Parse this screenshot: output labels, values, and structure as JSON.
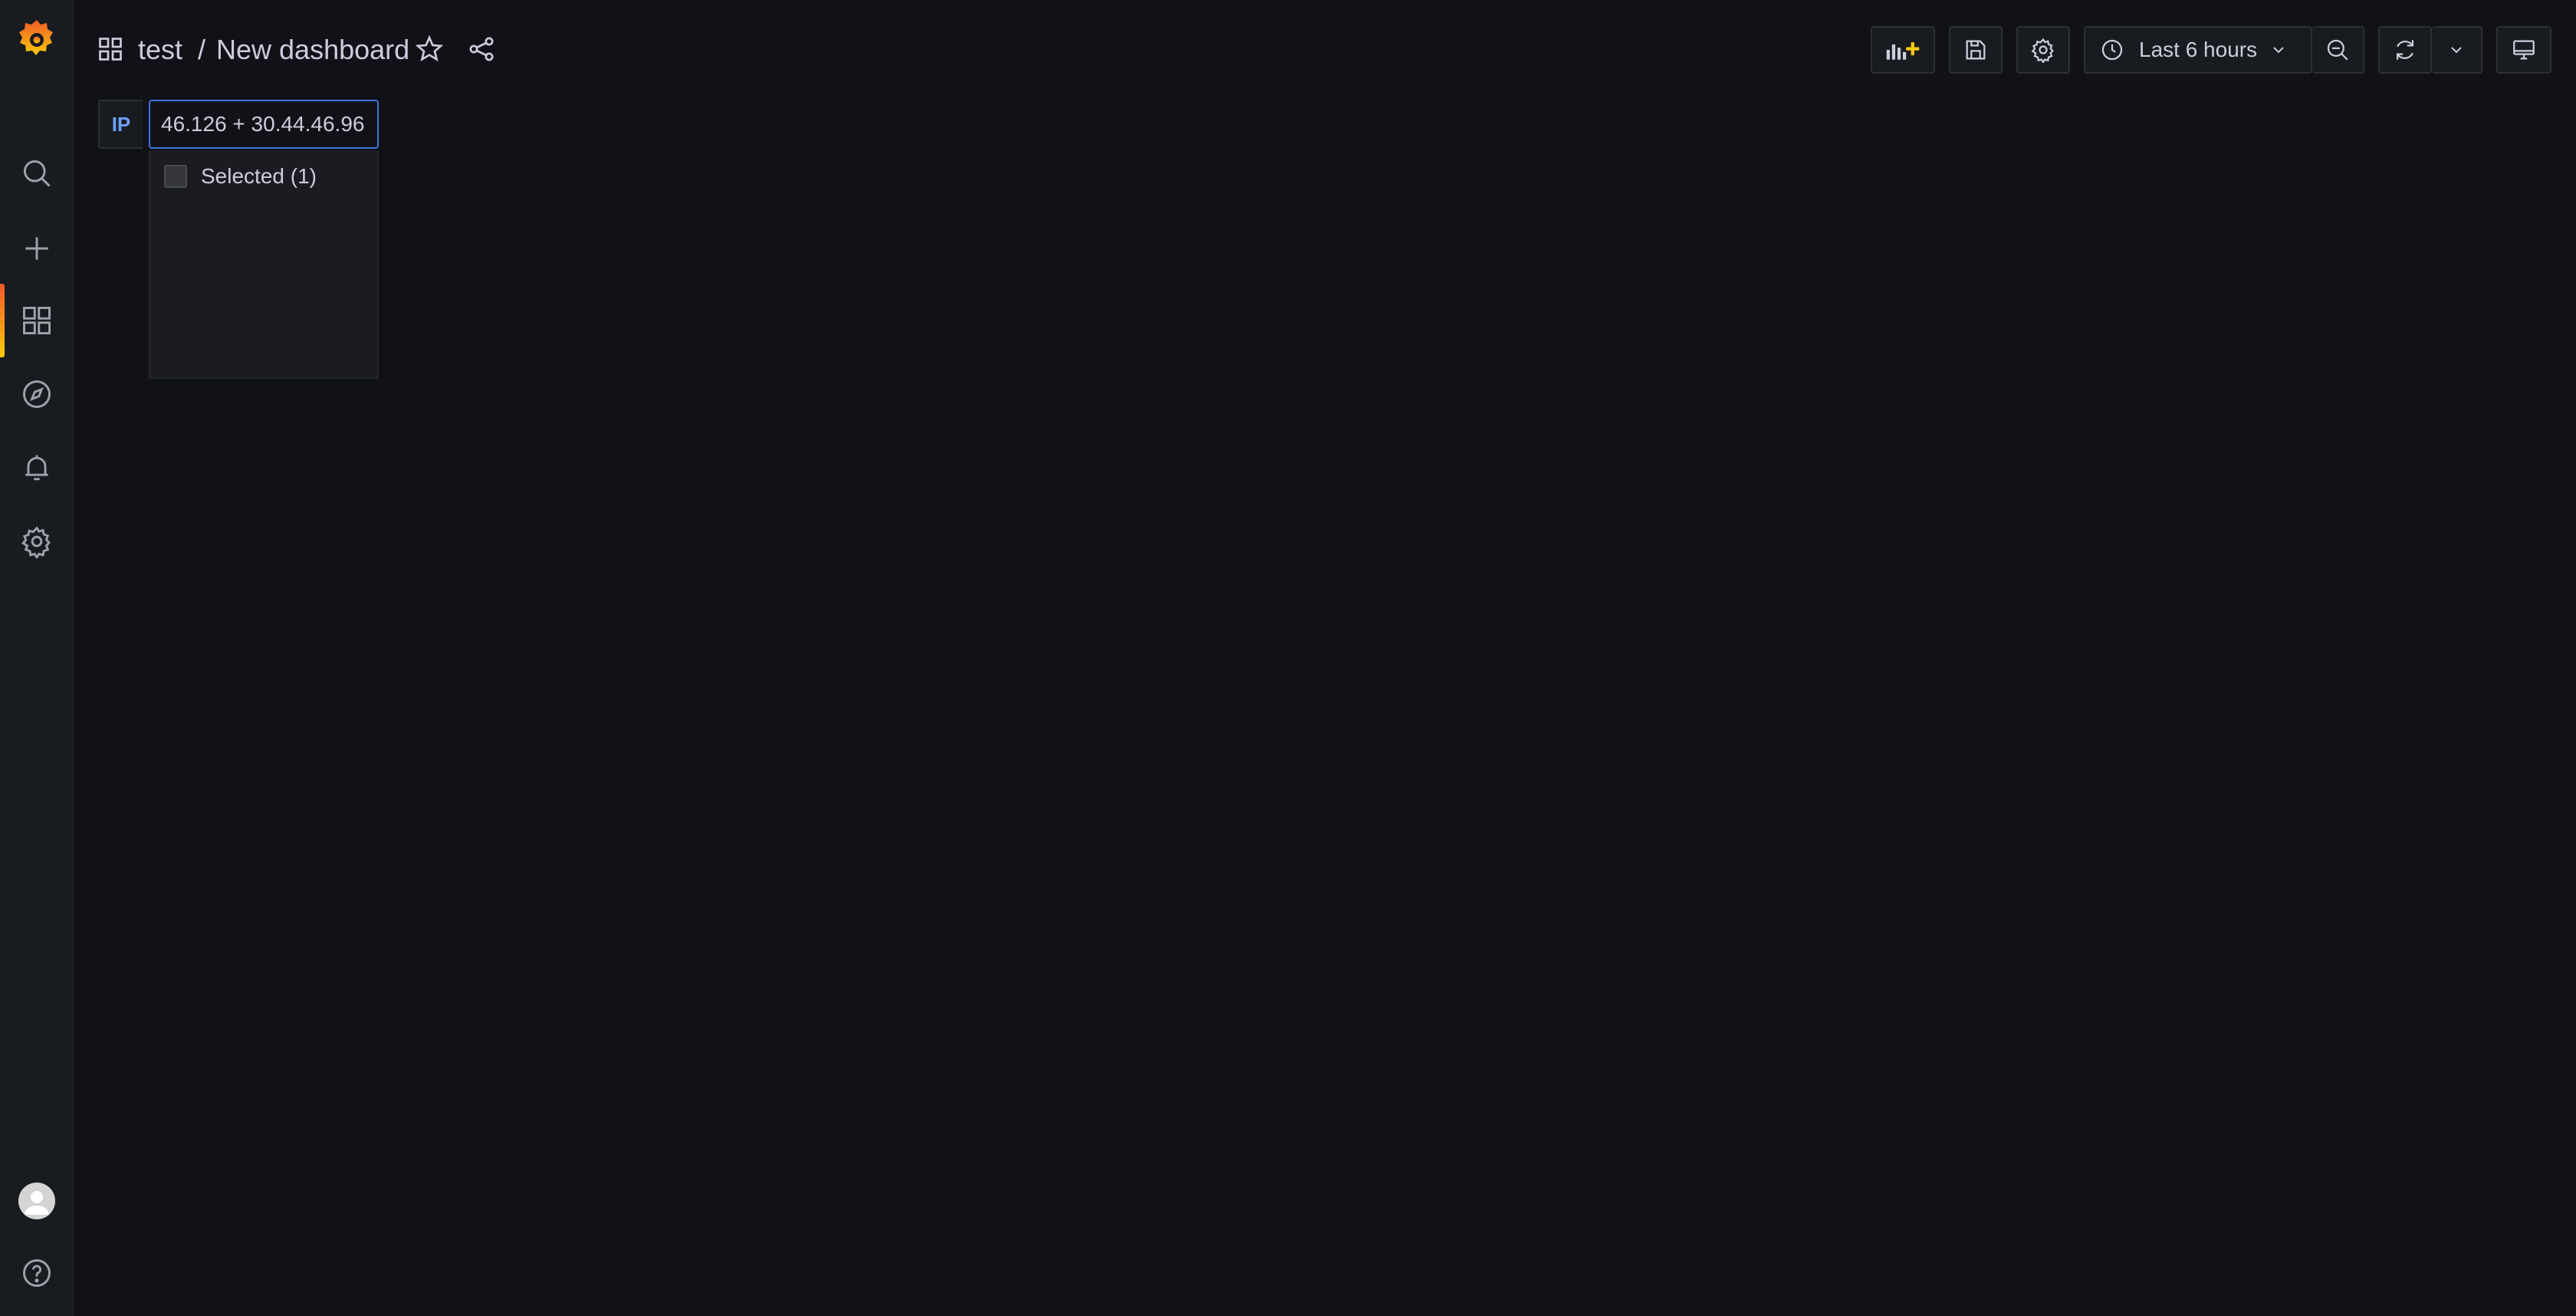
{
  "breadcrumb": {
    "folder": "test",
    "separator": "/",
    "dashboard": "New dashboard"
  },
  "toolbar": {
    "time_range": "Last 6 hours"
  },
  "variables": [
    {
      "label": "IP",
      "value": "46.126 + 30.44.46.96"
    }
  ],
  "dropdown": {
    "option_label": "Selected (1)"
  },
  "sidemenu": {
    "items": [
      "search-icon",
      "plus-icon",
      "dashboards-icon",
      "explore-icon",
      "alerting-icon",
      "gear-icon"
    ],
    "bottom": [
      "avatar",
      "help-icon"
    ]
  },
  "colors": {
    "background": "#111217",
    "sidemenu": "#181b1f",
    "variable_label": "#6e9fff",
    "focus_border": "#3d71d9",
    "brand": "#f05a28"
  }
}
